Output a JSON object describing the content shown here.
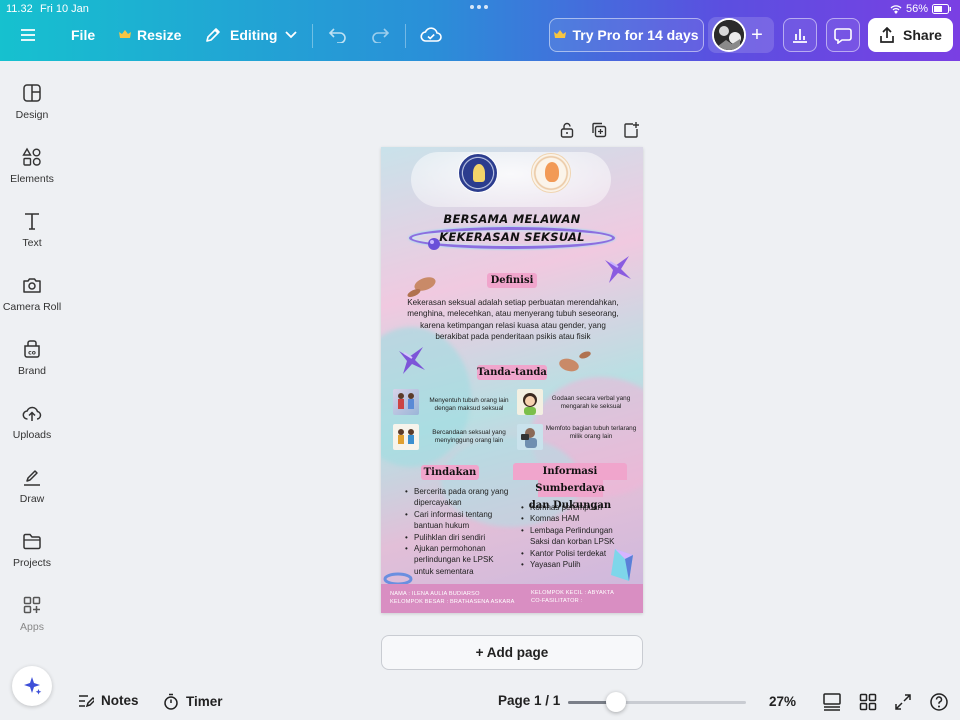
{
  "status": {
    "time": "11.32",
    "date": "Fri 10 Jan",
    "battery": "56%"
  },
  "toolbar": {
    "file": "File",
    "resize": "Resize",
    "editing": "Editing",
    "try_pro": "Try Pro for 14 days",
    "share": "Share"
  },
  "sidebar": {
    "items": [
      {
        "label": "Design"
      },
      {
        "label": "Elements"
      },
      {
        "label": "Text"
      },
      {
        "label": "Camera Roll"
      },
      {
        "label": "Brand"
      },
      {
        "label": "Uploads"
      },
      {
        "label": "Draw"
      },
      {
        "label": "Projects"
      },
      {
        "label": "Apps"
      }
    ]
  },
  "poster": {
    "title_line1": "BERSAMA MELAWAN",
    "title_line2": "KEKERASAN SEKSUAL",
    "definisi_heading": "Definisi",
    "definisi_text": "Kekerasan seksual adalah setiap perbuatan merendahkan, menghina, melecehkan, atau menyerang tubuh seseorang, karena ketimpangan relasi kuasa atau gender, yang berakibat pada penderitaan psikis atau fisik",
    "tanda_heading": "Tanda-tanda",
    "signs": [
      "Menyentuh tubuh orang lain dengan maksud seksual",
      "Godaan secara verbal yang mengarah ke seksual",
      "Bercandaan seksual yang menyinggung orang lain",
      "Memfoto bagian tubuh terlarang milik orang lain"
    ],
    "tindakan_heading": "Tindakan",
    "tindakan_items": [
      "Bercerita pada orang yang dipercayakan",
      "Cari informasi tentang bantuan hukum",
      "Pulihklan diri sendiri",
      "Ajukan permohonan perlindungan ke LPSK untuk sementara"
    ],
    "info_heading_line1": "Informasi Sumberdaya",
    "info_heading_line2": "dan Dukungan",
    "info_items": [
      "Komnas perempuan",
      "Komnas HAM",
      "Lembaga Perlindungan Saksi dan korban LPSK",
      "Kantor Polisi terdekat",
      "Yayasan Pulih"
    ],
    "footer_left_1": "NAMA : ILENA AULIA BUDIARSO",
    "footer_left_2": "KELOMPOK BESAR : BRATHASENA ASKARA",
    "footer_right_1": "KELOMPOK KECIL : ABYAKTA",
    "footer_right_2": "CO-FASILITATOR :"
  },
  "canvas": {
    "add_page": "+ Add page"
  },
  "bottombar": {
    "notes": "Notes",
    "timer": "Timer",
    "page_indicator": "Page 1 / 1",
    "zoom": "27%",
    "zoom_fraction": 0.27
  },
  "colors": {
    "accent_start": "#16c1cf",
    "accent_end": "#7a3fe3",
    "pill": "#f0a5cc",
    "footer": "#d98ec2"
  }
}
